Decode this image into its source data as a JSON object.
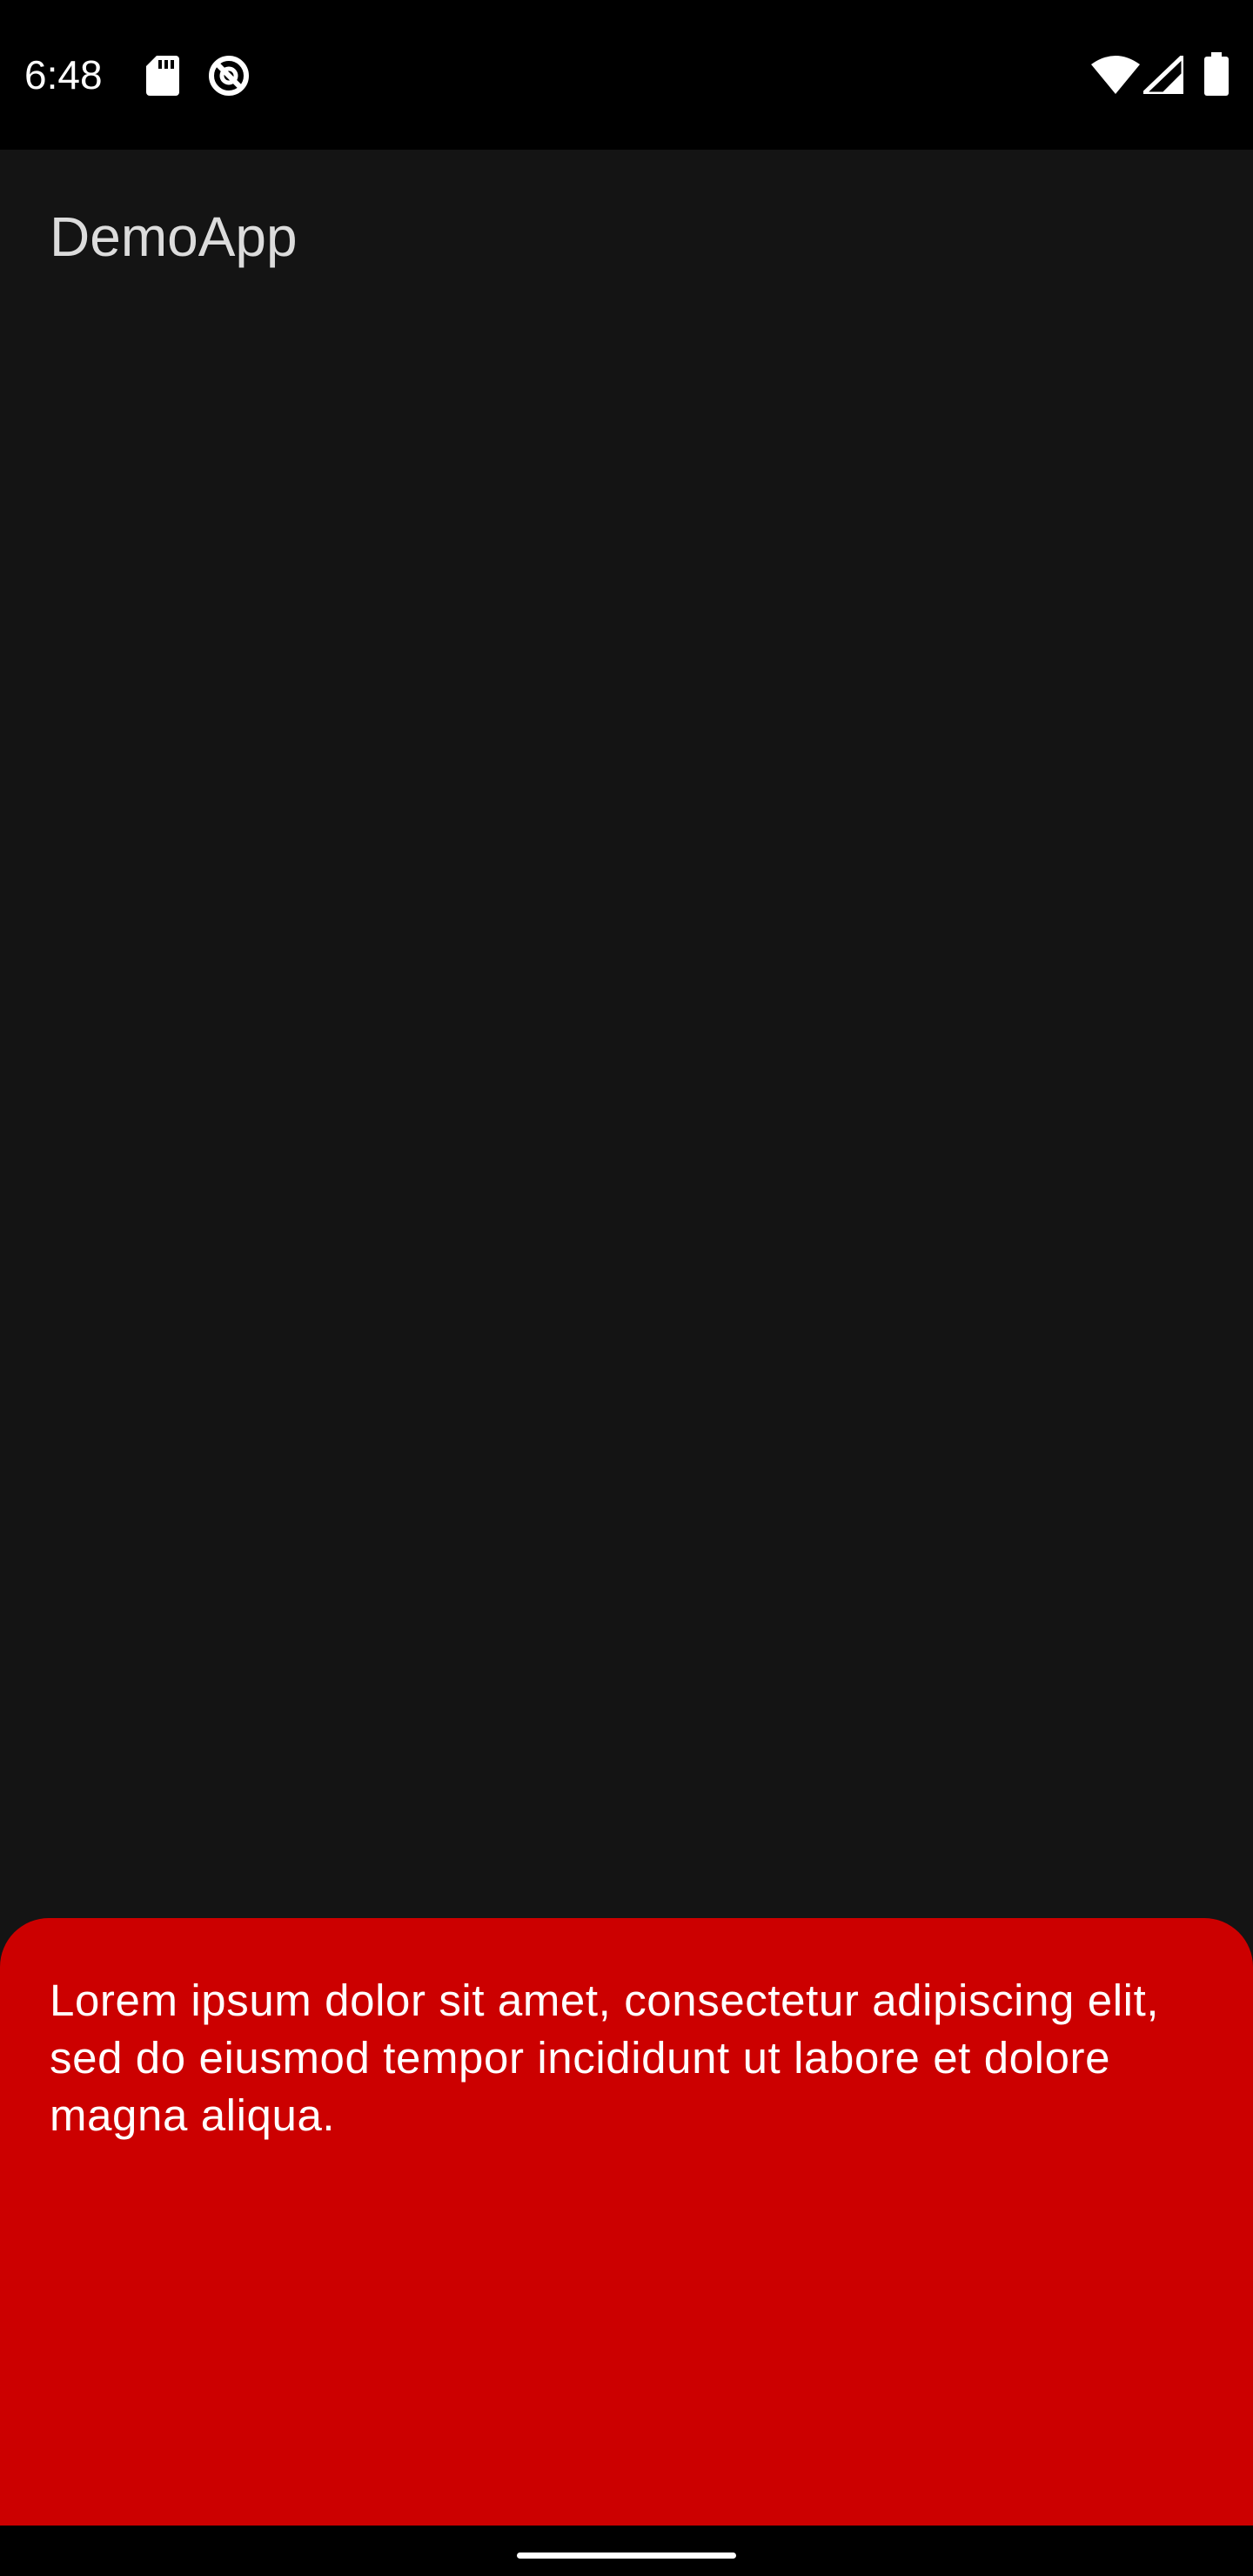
{
  "status_bar": {
    "time": "6:48",
    "icons": [
      "sd-card-icon",
      "vpn-icon",
      "wifi-icon",
      "cell-signal-icon",
      "battery-icon"
    ]
  },
  "app": {
    "title": "DemoApp"
  },
  "bottom_sheet": {
    "text": "Lorem ipsum dolor sit amet, consectetur adipiscing elit, sed do eiusmod tempor incididunt ut labore et dolore magna aliqua."
  },
  "colors": {
    "status_bar_bg": "#000000",
    "app_bg": "#141414",
    "title_text": "#dcdcdc",
    "sheet_bg": "#cc0000",
    "sheet_text": "#ffffff"
  }
}
